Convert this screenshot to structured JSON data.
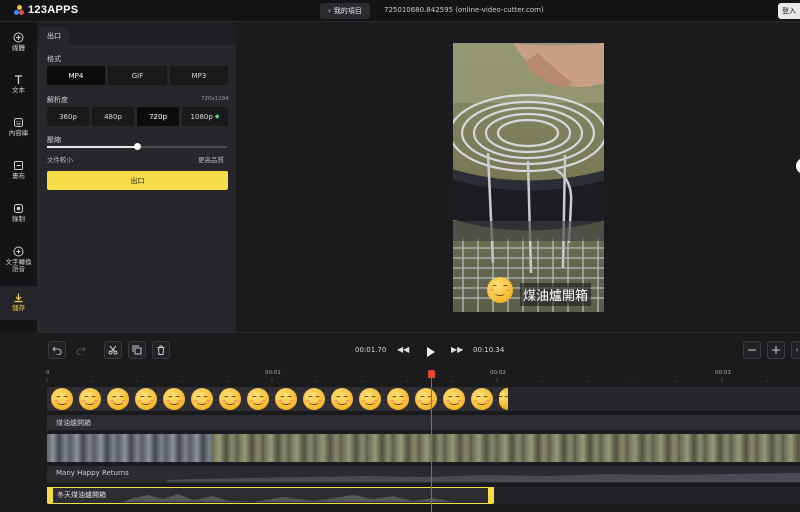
{
  "app": {
    "logo_text": "123APPS",
    "back_label": "我的項目",
    "project_title": "725010680.842595 (online-video-cutter.com)",
    "login_label": "登入"
  },
  "sidebar": {
    "items": [
      {
        "label": "媒體",
        "icon": "plus-circle-icon"
      },
      {
        "label": "文本",
        "icon": "text-icon"
      },
      {
        "label": "內容庫",
        "icon": "sticker-icon"
      },
      {
        "label": "畫布",
        "icon": "canvas-icon"
      },
      {
        "label": "錄制",
        "icon": "record-icon"
      },
      {
        "label": "文字轉換語音",
        "icon": "tts-icon"
      },
      {
        "label": "儲存",
        "icon": "download-icon",
        "active": true
      }
    ]
  },
  "export_panel": {
    "tab_label": "出口",
    "format_label": "格式",
    "formats": [
      "MP4",
      "GIF",
      "MP3"
    ],
    "selected_format": "MP4",
    "resolution_label": "解析度",
    "resolution_value": "720x1284",
    "resolutions": [
      "360p",
      "480p",
      "720p",
      "1080p"
    ],
    "selected_resolution": "720p",
    "compression_label": "壓縮",
    "compression_level": 0.5,
    "small_file_label": "文件較小",
    "better_quality_label": "更高品質",
    "export_button": "出口"
  },
  "preview": {
    "caption_text": "煤油爐開箱"
  },
  "timeline": {
    "current_time": "00:01.70",
    "total_time": "00:10.34",
    "ruler": [
      "0",
      "00:01",
      "00:02",
      "00:03"
    ],
    "text_track_label": "煤油爐開箱",
    "music_track_label": "Many Happy Returns",
    "voice_track_label": "冬天煤油爐開箱"
  },
  "colors": {
    "accent": "#f7dc4a",
    "playhead": "#e24a2f",
    "background": "#1b1b1e"
  }
}
